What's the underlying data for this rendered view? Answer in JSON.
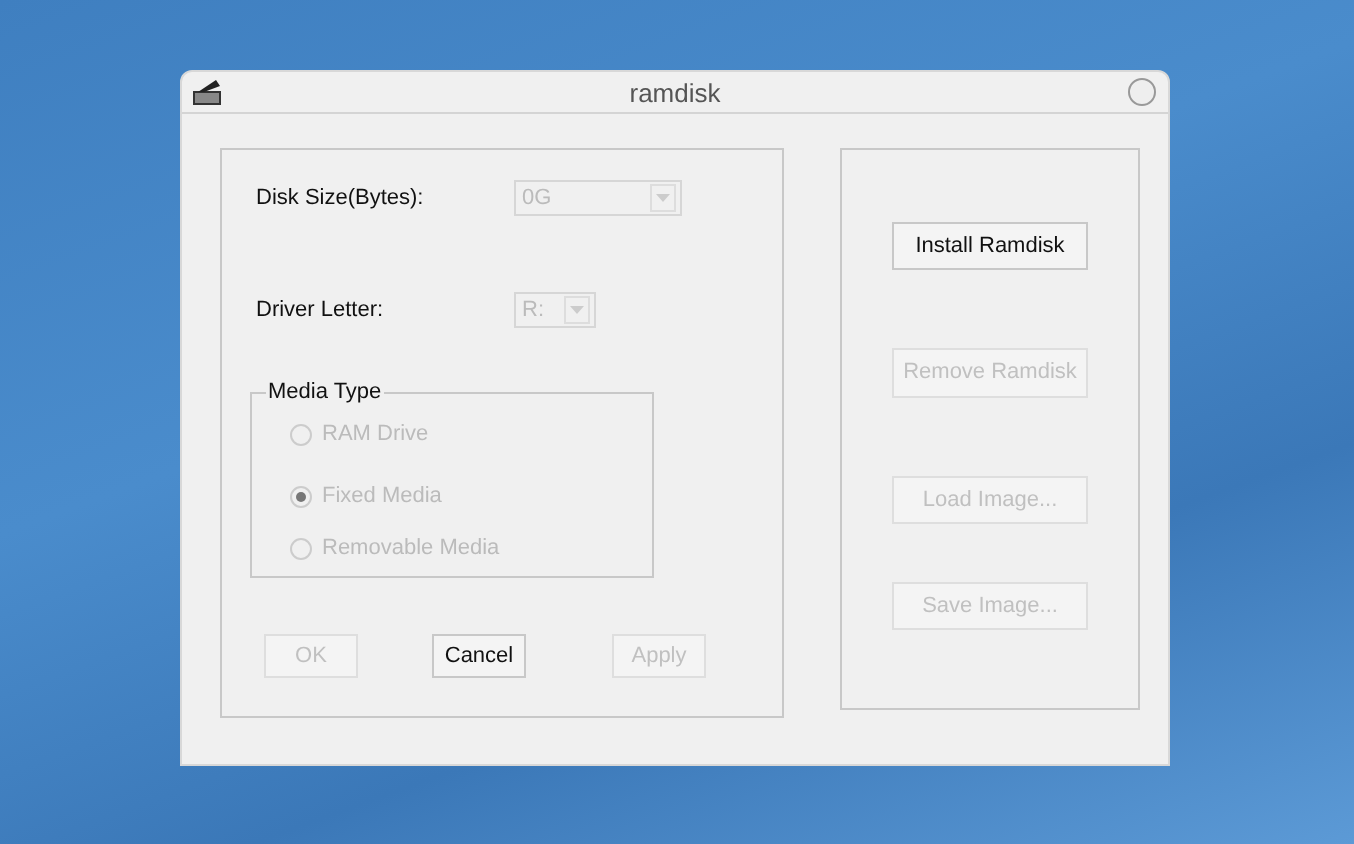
{
  "window": {
    "title": "ramdisk"
  },
  "fields": [
    {
      "label": "Disk Size(Bytes):",
      "value": "0G",
      "disabled": true,
      "kind": "wide"
    },
    {
      "label": "Driver Letter:",
      "value": "R:",
      "disabled": true,
      "kind": "narrow"
    }
  ],
  "media_type": {
    "label": "Media Type",
    "options": [
      {
        "label": "RAM Drive",
        "selected": false,
        "disabled": true
      },
      {
        "label": "Fixed Media",
        "selected": true,
        "disabled": true
      },
      {
        "label": "Removable Media",
        "selected": false,
        "disabled": true
      }
    ]
  },
  "buttons": [
    {
      "label": "OK",
      "disabled": true
    },
    {
      "label": "Cancel",
      "disabled": false
    },
    {
      "label": "Apply",
      "disabled": true
    }
  ],
  "side_buttons": [
    {
      "label": "Install Ramdisk",
      "disabled": false
    },
    {
      "label": "Remove Ramdisk",
      "disabled": true
    },
    {
      "label": "Load Image...",
      "disabled": true
    },
    {
      "label": "Save Image...",
      "disabled": true
    }
  ]
}
